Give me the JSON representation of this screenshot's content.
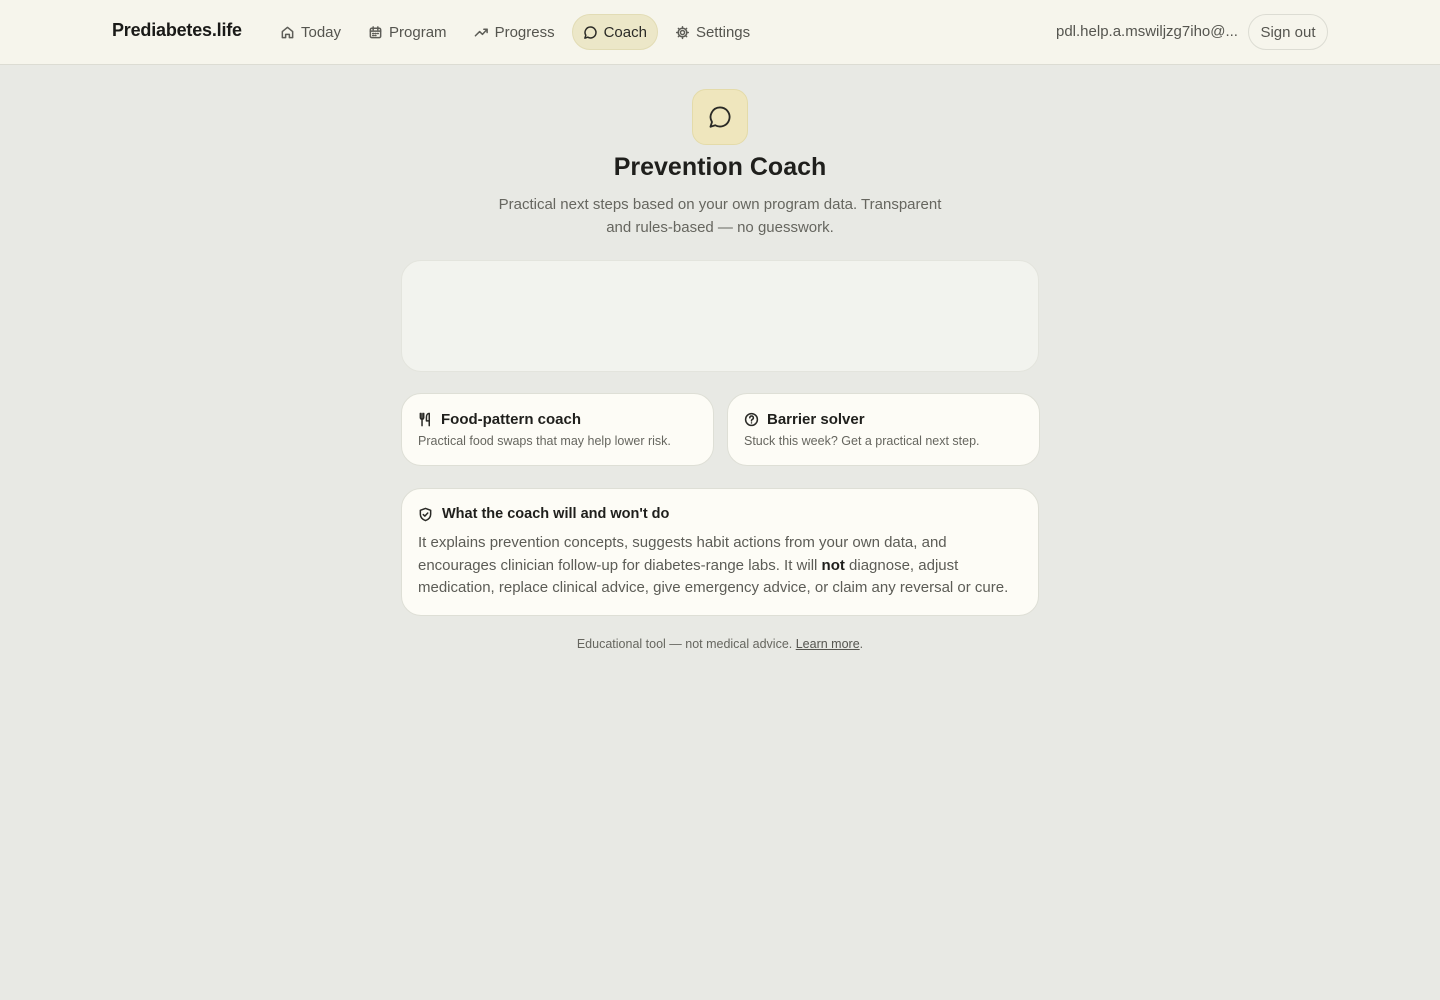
{
  "header": {
    "brand": "Prediabetes.life",
    "nav": [
      {
        "label": "Today",
        "icon": "home-icon"
      },
      {
        "label": "Program",
        "icon": "calendar-icon"
      },
      {
        "label": "Progress",
        "icon": "trending-up-icon"
      },
      {
        "label": "Coach",
        "icon": "chat-bubble-icon",
        "active": true
      },
      {
        "label": "Settings",
        "icon": "gear-icon"
      }
    ],
    "email": "pdl.help.a.mswiljzg7iho@...",
    "sign_out": "Sign out"
  },
  "hero": {
    "icon": "chat-bubble-icon",
    "title": "Prevention Coach",
    "subtitle": "Practical next steps based on your own program data. Transparent and rules-based — no guesswork."
  },
  "cards": [
    {
      "title": "Food-pattern coach",
      "desc": "Practical food swaps that may help lower risk.",
      "icon": "utensils-icon"
    },
    {
      "title": "Barrier solver",
      "desc": "Stuck this week? Get a practical next step.",
      "icon": "help-circle-icon"
    }
  ],
  "info": {
    "title": "What the coach will and won't do",
    "icon": "shield-check-icon",
    "body_before": "It explains prevention concepts, suggests habit actions from your own data, and encourages clinician follow-up for diabetes-range labs. It will ",
    "body_bold": "not",
    "body_after": " diagnose, adjust medication, replace clinical advice, give emergency advice, or claim any reversal or cure."
  },
  "footer": {
    "text": "Educational tool — not medical advice. ",
    "link": "Learn more",
    "end": "."
  },
  "colors": {
    "page_bg": "#e8e9e4",
    "header_bg": "#f6f5ec",
    "active_nav": "#ece7c8",
    "card_bg": "#fdfcf6"
  }
}
